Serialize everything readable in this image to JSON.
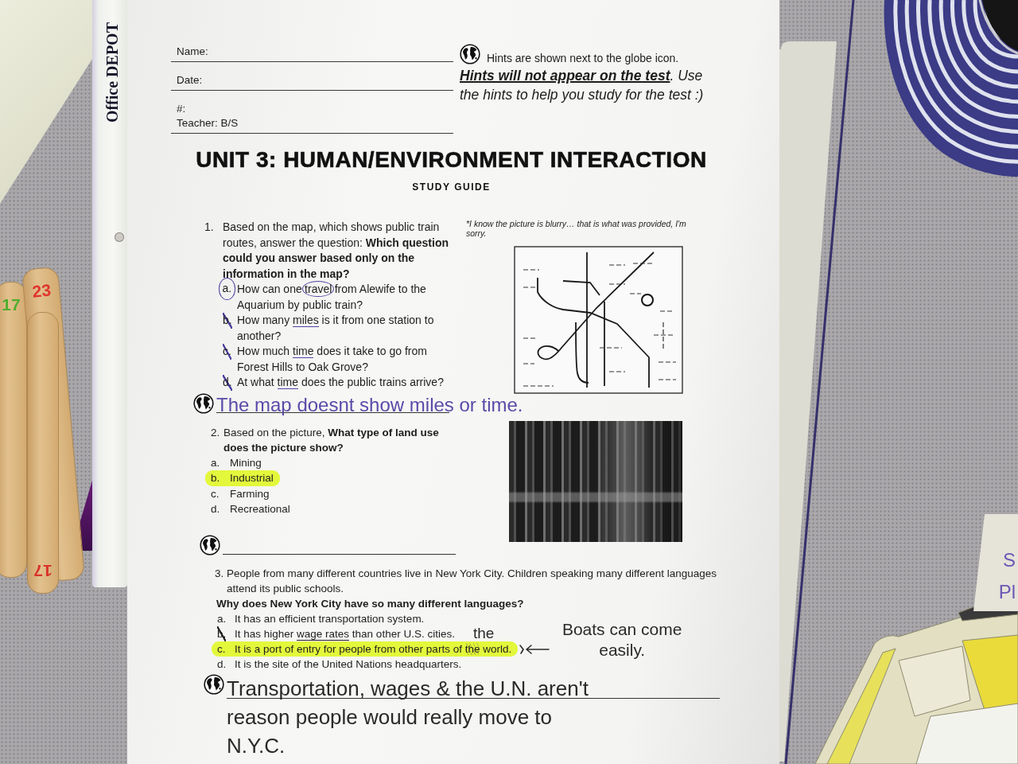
{
  "desk": {
    "binder_strip": {
      "brand": "Office DEPOT"
    },
    "sticks": [
      {
        "label": "17",
        "color": "#4fae2e",
        "upside_down": false
      },
      {
        "label": "17",
        "color": "#d8322b",
        "upside_down": true
      },
      {
        "label": "23",
        "color": "#e0352d",
        "upside_down": false
      }
    ],
    "side_note": {
      "lines": [
        "S",
        "Pl"
      ]
    }
  },
  "worksheet": {
    "fields": [
      {
        "labels": [
          "Name:"
        ]
      },
      {
        "labels": [
          "Date:"
        ]
      },
      {
        "labels": [
          "#:",
          "Teacher: B/S"
        ]
      }
    ],
    "hint_note": "Hints are shown next to the globe icon.",
    "hint_warning": "**Hints will not appear on the test**. Use the hints to help you study for the test :)",
    "title": "UNIT 3: HUMAN/ENVIRONMENT INTERACTION",
    "subtitle": "STUDY GUIDE",
    "questions": [
      {
        "number": "1.",
        "kind": "circled",
        "prompt": "Based on the map, which shows public train routes, answer the question: **Which question could you answer based only on the information in the map?**",
        "figure": {
          "kind": "map",
          "caption": "*I know the picture is blurry… that is what was provided, I'm sorry."
        },
        "options": [
          {
            "letter": "a.",
            "selected": true,
            "crossed_out": false,
            "segments": [
              {
                "kind": "plain",
                "text": "How can one "
              },
              {
                "kind": "circled",
                "text": "travel"
              },
              {
                "kind": "plain",
                "text": " from Alewife to the Aquarium by public train?"
              }
            ]
          },
          {
            "letter": "b.",
            "selected": false,
            "crossed_out": true,
            "segments": [
              {
                "kind": "plain",
                "text": "How many "
              },
              {
                "kind": "underlined",
                "text": "miles"
              },
              {
                "kind": "plain",
                "text": " is it from one station to another?"
              }
            ]
          },
          {
            "letter": "c.",
            "selected": false,
            "crossed_out": true,
            "segments": [
              {
                "kind": "plain",
                "text": "How much "
              },
              {
                "kind": "underlined",
                "text": "time"
              },
              {
                "kind": "plain",
                "text": " does it take to go from Forest Hills to Oak Grove?"
              }
            ]
          },
          {
            "letter": "d.",
            "selected": false,
            "crossed_out": true,
            "segments": [
              {
                "kind": "plain",
                "text": "At what "
              },
              {
                "kind": "underlined",
                "text": "time"
              },
              {
                "kind": "plain",
                "text": " does the public trains arrive?"
              }
            ]
          }
        ],
        "hint_answer": "The map doesnt show miles or time."
      },
      {
        "number": "2.",
        "kind": "highlighted",
        "prompt": "Based on the picture, **What type of land use does the picture show?**",
        "figure": {
          "kind": "photo"
        },
        "options": [
          {
            "letter": "a.",
            "selected": false,
            "crossed_out": false,
            "segments": [
              {
                "kind": "plain",
                "text": "Mining"
              }
            ]
          },
          {
            "letter": "b.",
            "selected": true,
            "crossed_out": false,
            "segments": [
              {
                "kind": "plain",
                "text": "Industrial"
              }
            ]
          },
          {
            "letter": "c.",
            "selected": false,
            "crossed_out": false,
            "segments": [
              {
                "kind": "plain",
                "text": "Farming"
              }
            ]
          },
          {
            "letter": "d.",
            "selected": false,
            "crossed_out": false,
            "segments": [
              {
                "kind": "plain",
                "text": "Recreational"
              }
            ]
          }
        ]
      },
      {
        "number": "3.",
        "kind": "highlighted",
        "prompt": "People from many different countries live in New York City. Children speaking many different languages attend its public schools.",
        "question": "Why does New York City have so many different languages?",
        "options": [
          {
            "letter": "a.",
            "selected": false,
            "crossed_out": false,
            "segments": [
              {
                "kind": "plain",
                "text": "It has an efficient transportation system."
              }
            ]
          },
          {
            "letter": "b.",
            "selected": false,
            "crossed_out": true,
            "segments": [
              {
                "kind": "plain",
                "text": "It has higher "
              },
              {
                "kind": "underlined",
                "text": "wage rates"
              },
              {
                "kind": "plain",
                "text": " than other U.S. cities."
              }
            ]
          },
          {
            "letter": "c.",
            "selected": true,
            "crossed_out": false,
            "segments": [
              {
                "kind": "plain",
                "text": "It is a port of entry for people from other parts of "
              },
              {
                "kind": "scribbled",
                "text": "the",
                "correction": "the"
              },
              {
                "kind": "plain",
                "text": " world."
              }
            ],
            "note": "Boats can come easily."
          },
          {
            "letter": "d.",
            "selected": false,
            "crossed_out": false,
            "segments": [
              {
                "kind": "plain",
                "text": "It is the site of the United Nations headquarters."
              }
            ]
          }
        ],
        "hint_answer": "Transportation, wages & the U.N. aren't reason people would really move to N.Y.C."
      }
    ]
  }
}
